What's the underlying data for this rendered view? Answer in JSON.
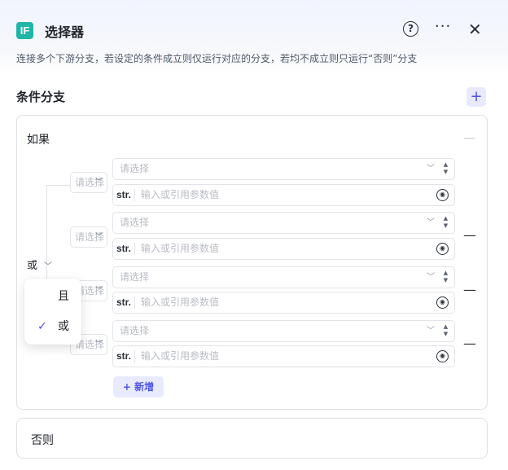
{
  "header": {
    "logo_text": "IF",
    "title": "选择器",
    "help_glyph": "?",
    "more_glyph": "···",
    "close_glyph": "✕",
    "description": "连接多个下游分支，若设定的条件成立则仅运行对应的分支，若均不成立则只运行“否则”分支"
  },
  "section": {
    "title": "条件分支",
    "add_glyph": "+"
  },
  "if_card": {
    "title": "如果",
    "collapse_glyph": "—",
    "logic_value": "或",
    "logic_options": [
      {
        "label": "且",
        "selected": false
      },
      {
        "label": "或",
        "selected": true
      }
    ],
    "conditions": [
      {
        "left_placeholder": "请选择",
        "operator_placeholder": "请选择",
        "value_type": "str.",
        "value_placeholder": "输入或引用参数值",
        "removable": false
      },
      {
        "left_placeholder": "请选择",
        "operator_placeholder": "请选择",
        "value_type": "str.",
        "value_placeholder": "输入或引用参数值",
        "removable": true
      },
      {
        "left_placeholder": "请选择",
        "operator_placeholder": "请选择",
        "value_type": "str.",
        "value_placeholder": "输入或引用参数值",
        "removable": true
      },
      {
        "left_placeholder": "请选择",
        "operator_placeholder": "请选择",
        "value_type": "str.",
        "value_placeholder": "输入或引用参数值",
        "removable": true
      }
    ],
    "add_condition_label": "+ 新增",
    "remove_glyph": "—"
  },
  "else_card": {
    "title": "否则"
  },
  "colors": {
    "accent": "#4d53e8",
    "accent_bg": "#e8ebff",
    "logo": "#1fb6a8",
    "border": "#dde0e6",
    "placeholder": "#b9bcc4"
  },
  "icons": {
    "help": "help-circle-icon",
    "more": "more-horizontal-icon",
    "close": "close-icon",
    "reference": "reference-icon",
    "chevron": "chevron-down-icon",
    "sort": "sort-updown-icon",
    "check": "check-icon"
  }
}
